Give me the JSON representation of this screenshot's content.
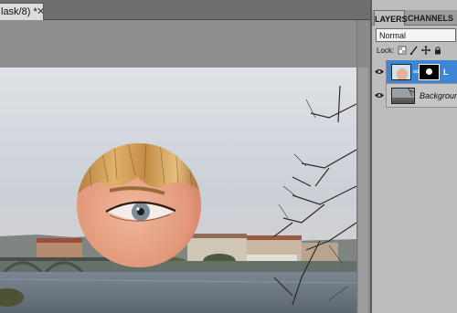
{
  "document": {
    "tab_title": "lask/8) *",
    "close_glyph": "✕"
  },
  "layers_panel": {
    "tabs": [
      {
        "label": "LAYERS",
        "active": true
      },
      {
        "label": "CHANNELS",
        "active": false
      }
    ],
    "blend_mode": "Normal",
    "lock_label": "Lock:",
    "lock_icons": [
      "lock-transparent-icon",
      "lock-paint-icon",
      "lock-move-icon",
      "lock-all-icon"
    ],
    "layers": [
      {
        "name": "L",
        "selected": true,
        "visible": true,
        "has_mask": true,
        "thumb": "face-thumbnail-icon",
        "mask": "circle-mask-icon"
      },
      {
        "name": "Background",
        "selected": false,
        "visible": true,
        "has_mask": false,
        "thumb": "city-thumbnail-icon"
      }
    ]
  },
  "colors": {
    "selection_blue": "#3d86d6",
    "panel_gray": "#bdbdbd",
    "workspace_gray": "#8e8e8e"
  }
}
